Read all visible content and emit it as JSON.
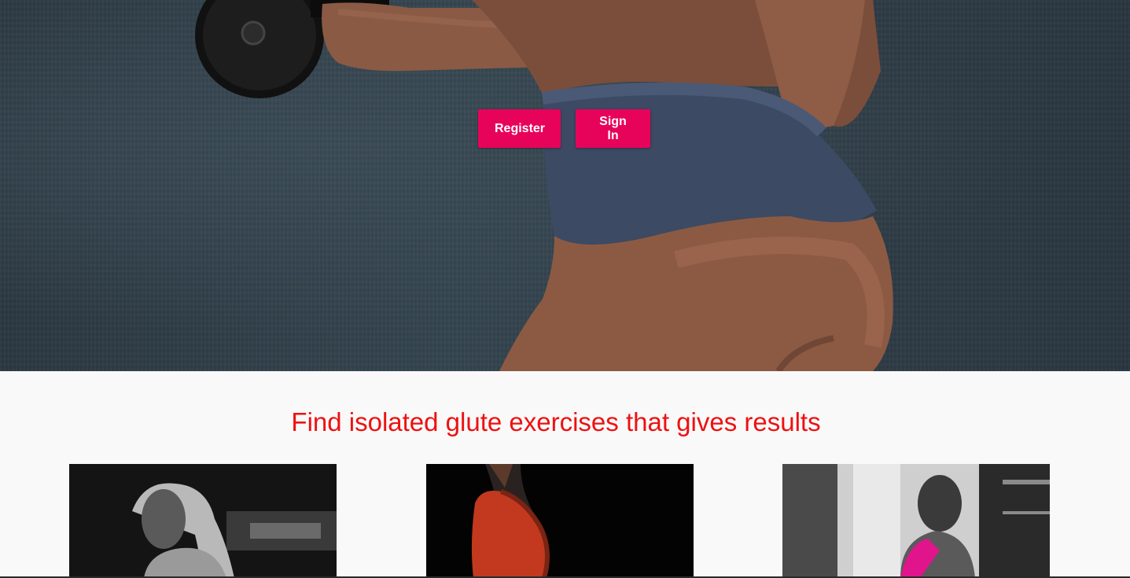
{
  "hero": {
    "image": "fitness-woman-with-dumbbell",
    "buttons": {
      "register_label": "Register",
      "signin_label": "Sign In"
    },
    "button_color": "#e8035a"
  },
  "section": {
    "headline": "Find isolated glute exercises that gives results",
    "headline_color": "#ee1111",
    "cards": [
      {
        "image": "blonde-woman-grayscale-photo"
      },
      {
        "image": "woman-red-top-dark-photo"
      },
      {
        "image": "woman-pink-sports-bra-gym-photo"
      }
    ]
  }
}
